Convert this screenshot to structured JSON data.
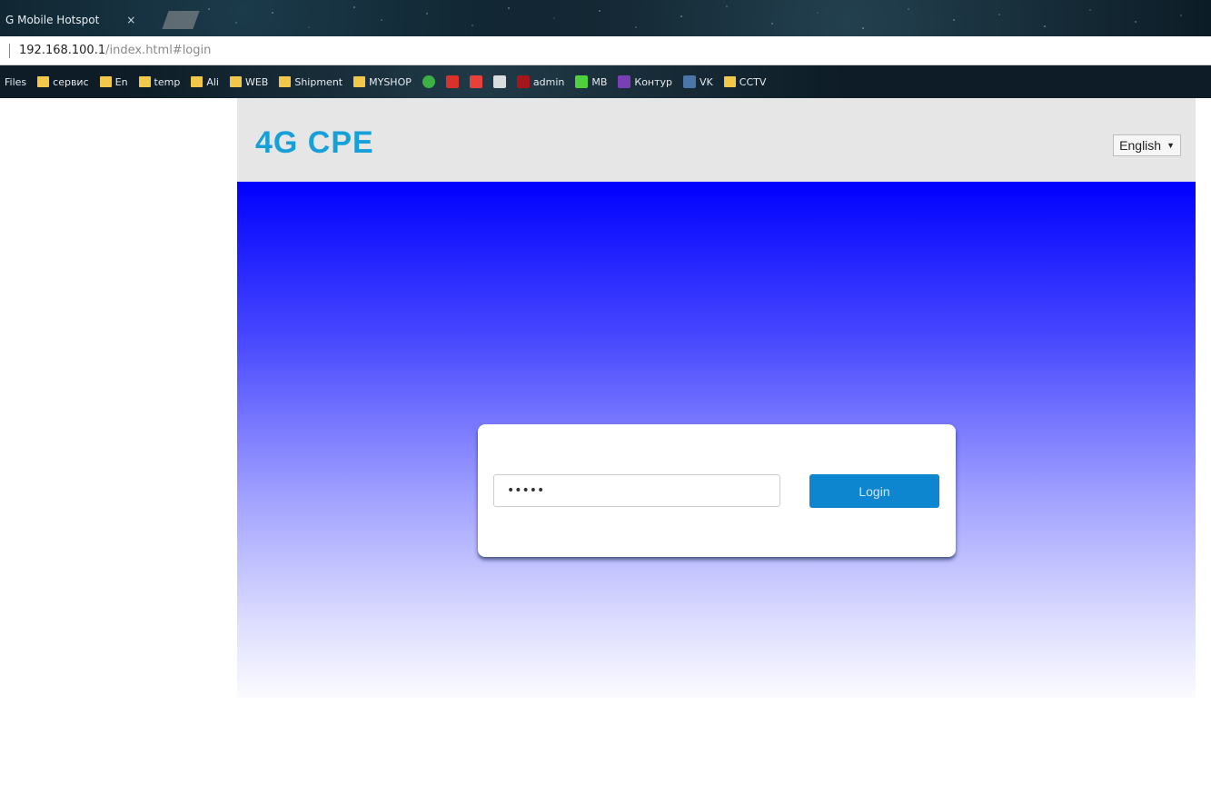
{
  "browser": {
    "tab_title": "G Mobile Hotspot",
    "tab_close": "×",
    "url_host": "192.168.100.1",
    "url_path": "/index.html#login",
    "bookmarks": [
      "Files",
      "сервис",
      "En",
      "temp",
      "Ali",
      "WEB",
      "Shipment",
      "MYSHOP",
      "admin",
      "MB",
      "Контур",
      "VK",
      "CCTV"
    ]
  },
  "page": {
    "logo": "4G CPE",
    "language": "English",
    "language_caret": "▼",
    "password_value": "•••••",
    "login_label": "Login"
  },
  "colors": {
    "logo": "#16a0d8",
    "login_button": "#0e86cf",
    "hero_top": "#0000ff",
    "hero_bottom": "#fbfbff",
    "header_bg": "#e6e6e6"
  }
}
